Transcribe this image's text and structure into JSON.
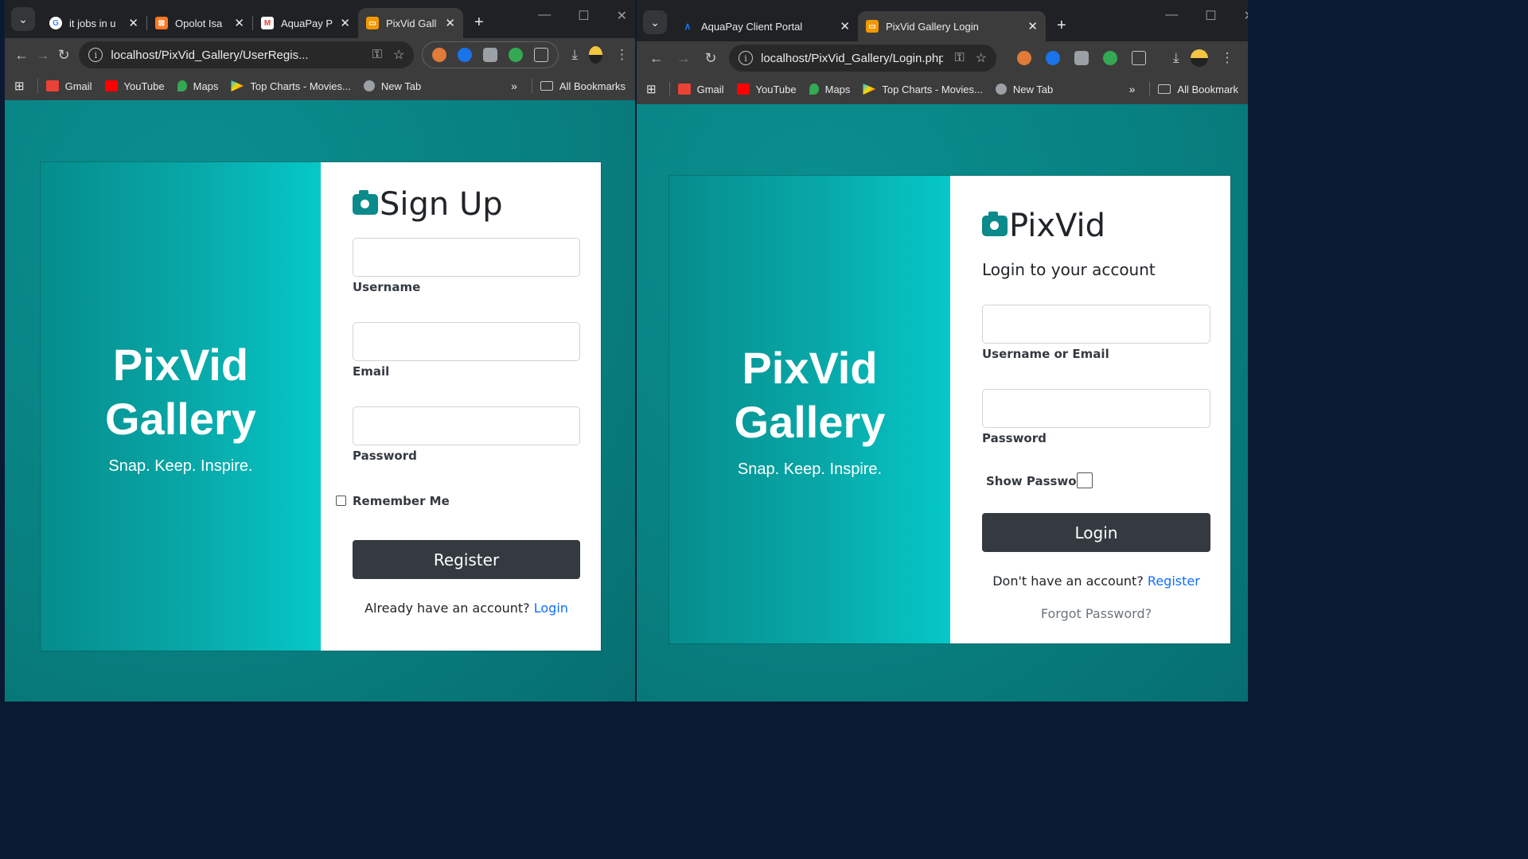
{
  "left_window": {
    "tabs": [
      {
        "title": "it jobs in u",
        "favicon": "google-icon",
        "active": false
      },
      {
        "title": "Opolot Isa",
        "favicon": "xampp-icon",
        "active": false
      },
      {
        "title": "AquaPay P",
        "favicon": "gmail-icon",
        "active": false
      },
      {
        "title": "PixVid Gall",
        "favicon": "localhost-icon",
        "active": true
      }
    ],
    "url": "localhost/PixVid_Gallery/UserRegis...",
    "bookmarks": [
      "Gmail",
      "YouTube",
      "Maps",
      "Top Charts - Movies...",
      "New Tab"
    ],
    "all_bookmarks": "All Bookmarks",
    "brand": {
      "title_line1": "PixVid",
      "title_line2": "Gallery",
      "tagline": "Snap. Keep. Inspire."
    },
    "form": {
      "heading": "Sign Up",
      "username_label": "Username",
      "email_label": "Email",
      "password_label": "Password",
      "remember_label": "Remember Me",
      "register_button": "Register",
      "login_prompt": "Already have an account?",
      "login_link": "Login"
    }
  },
  "right_window": {
    "tabs": [
      {
        "title": "AquaPay Client Portal",
        "favicon": "aquapay-icon",
        "active": false
      },
      {
        "title": "PixVid Gallery Login",
        "favicon": "localhost-icon",
        "active": true
      }
    ],
    "url": "localhost/PixVid_Gallery/Login.php",
    "bookmarks": [
      "Gmail",
      "YouTube",
      "Maps",
      "Top Charts - Movies...",
      "New Tab"
    ],
    "all_bookmarks": "All Bookmark",
    "brand": {
      "title_line1": "PixVid",
      "title_line2": "Gallery",
      "tagline": "Snap. Keep. Inspire."
    },
    "form": {
      "heading": "PixVid",
      "subheading": "Login to your account",
      "username_label": "Username or Email",
      "password_label": "Password",
      "show_password_label": "Show Password",
      "login_button": "Login",
      "register_prompt": "Don't have an account?",
      "register_link": "Register",
      "forgot_link": "Forgot Password?"
    }
  },
  "colors": {
    "teal": "#087f80",
    "accent": "#0a8a8a",
    "button": "#343a40",
    "link": "#0d6efd"
  }
}
